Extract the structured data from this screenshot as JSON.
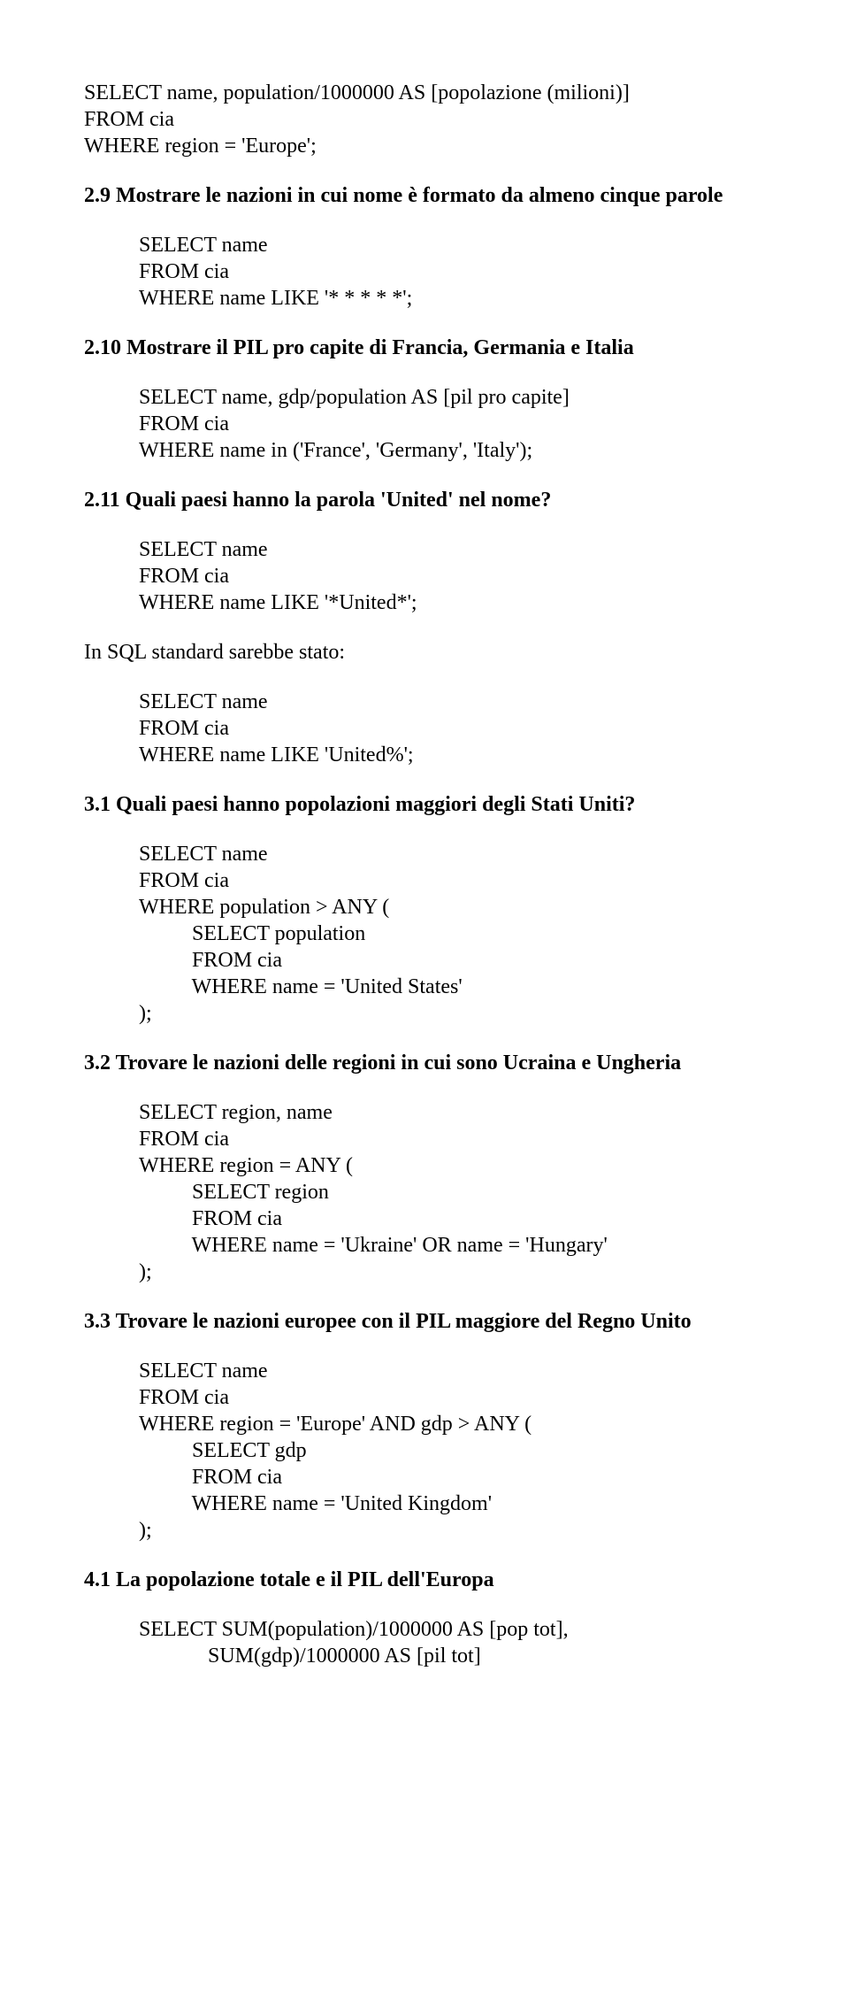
{
  "s0": {
    "code": "SELECT name, population/1000000 AS [popolazione (milioni)]\nFROM cia\nWHERE region = 'Europe';"
  },
  "s1": {
    "q": "2.9 Mostrare le nazioni in cui nome è formato da almeno cinque parole",
    "code": "SELECT name\nFROM cia\nWHERE name LIKE '* * * * *';"
  },
  "s2": {
    "q": "2.10 Mostrare il PIL pro capite di Francia, Germania e Italia",
    "code": "SELECT name, gdp/population AS [pil pro capite]\nFROM cia\nWHERE name in ('France', 'Germany', 'Italy');"
  },
  "s3": {
    "q": "2.11 Quali paesi hanno la parola 'United' nel nome?",
    "code1": "SELECT name\nFROM cia\nWHERE name LIKE '*United*';",
    "narr": "In SQL standard sarebbe stato:",
    "code2": "SELECT name\nFROM cia\nWHERE name LIKE 'United%';"
  },
  "s4": {
    "q": "3.1 Quali paesi hanno popolazioni maggiori degli Stati Uniti?",
    "code": "SELECT name\nFROM cia\nWHERE population > ANY (\n          SELECT population\n          FROM cia\n          WHERE name = 'United States'\n);"
  },
  "s5": {
    "q": "3.2 Trovare le nazioni delle regioni in cui sono Ucraina e Ungheria",
    "code": "SELECT region, name\nFROM cia\nWHERE region = ANY (\n          SELECT region\n          FROM cia\n          WHERE name = 'Ukraine' OR name = 'Hungary'\n);"
  },
  "s6": {
    "q": "3.3 Trovare le nazioni europee con il PIL maggiore del Regno Unito",
    "code": "SELECT name\nFROM cia\nWHERE region = 'Europe' AND gdp > ANY (\n          SELECT gdp\n          FROM cia\n          WHERE name = 'United Kingdom'\n);"
  },
  "s7": {
    "q": "4.1 La popolazione totale e il PIL dell'Europa",
    "code": "SELECT SUM(population)/1000000 AS [pop tot],\n             SUM(gdp)/1000000 AS [pil tot]"
  }
}
